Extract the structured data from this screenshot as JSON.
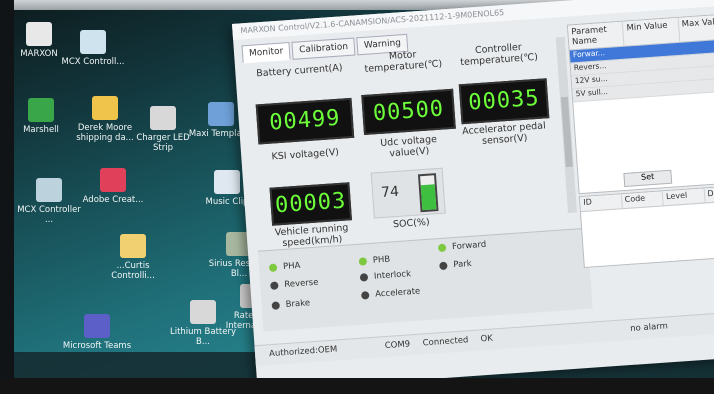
{
  "desktop": {
    "icons": [
      {
        "label": "MARXON",
        "color": "#e8e8e8"
      },
      {
        "label": "MCX Controll...",
        "color": "#cfe3ee"
      },
      {
        "label": "Marshell",
        "color": "#3aa64a"
      },
      {
        "label": "Derek Moore shipping da...",
        "color": "#f0c44a"
      },
      {
        "label": "Charger LED Strip",
        "color": "#d8d8d8"
      },
      {
        "label": "Maxi Templat...",
        "color": "#6fa0d8"
      },
      {
        "label": "MCX Controller ...",
        "color": "#bcd2dc"
      },
      {
        "label": "Adobe Creat...",
        "color": "#e0405a"
      },
      {
        "label": "Music Clip",
        "color": "#dfe8f0"
      },
      {
        "label": "...Curtis Controlli...",
        "color": "#f0d070"
      },
      {
        "label": "Sirius Reservd Bl...",
        "color": "#a8b8a0"
      },
      {
        "label": "Lithium Battery B...",
        "color": "#d8d8d8"
      },
      {
        "label": "Rate and Internal Co...",
        "color": "#c8c8c8"
      },
      {
        "label": "Microsoft Teams",
        "color": "#5b5fc7"
      }
    ]
  },
  "app": {
    "title": "MARXON Control/V2.1.6-CANAMSION/ACS-2021112-1-9M0ENOL65",
    "tabs": [
      "Monitor",
      "Calibration",
      "Warning"
    ],
    "active_tab": "Monitor",
    "gauges": {
      "battery_current": {
        "label": "Battery current(A)",
        "value": "00499"
      },
      "motor_temp": {
        "label": "Motor temperature(℃)",
        "value": "00500"
      },
      "controller_temp": {
        "label": "Controller temperature(℃)",
        "value": "00035"
      },
      "ksi_voltage": {
        "label": "KSI voltage(V)"
      },
      "udc_voltage": {
        "label": "Udc voltage value(V)"
      },
      "accelerator": {
        "label": "Accelerator pedal sensor(V)"
      },
      "vehicle_speed": {
        "label": "Vehicle running speed(km/h)",
        "value": "00003"
      },
      "soc": {
        "label": "SOC(%)",
        "value": "74",
        "level": 0.74
      }
    },
    "indicators": [
      {
        "label": "PHA",
        "on": true
      },
      {
        "label": "PHB",
        "on": true
      },
      {
        "label": "Forward",
        "on": true
      },
      {
        "label": "Reverse",
        "on": false
      },
      {
        "label": "Interlock",
        "on": false
      },
      {
        "label": "Park",
        "on": false
      },
      {
        "label": "Brake",
        "on": false
      },
      {
        "label": "Accelerate",
        "on": false
      }
    ],
    "param_table": {
      "headers": [
        "Paramet Name",
        "Min Value",
        "Max Value"
      ],
      "rows": [
        "Forwar...",
        "Revers...",
        "12V su...",
        "5V sull..."
      ]
    },
    "set_button": "Set",
    "fault_table": {
      "headers": [
        "ID",
        "Code",
        "Level",
        "Date"
      ]
    },
    "statusbar": {
      "authorized": "Authorized:OEM",
      "port": "COM9",
      "connection": "Connected",
      "ok": "OK",
      "no_alarm": "no alarm"
    },
    "colors": {
      "lcd_text": "#6cff3a",
      "indicator_on": "#7ec93f",
      "selection": "#3f78d8"
    }
  }
}
